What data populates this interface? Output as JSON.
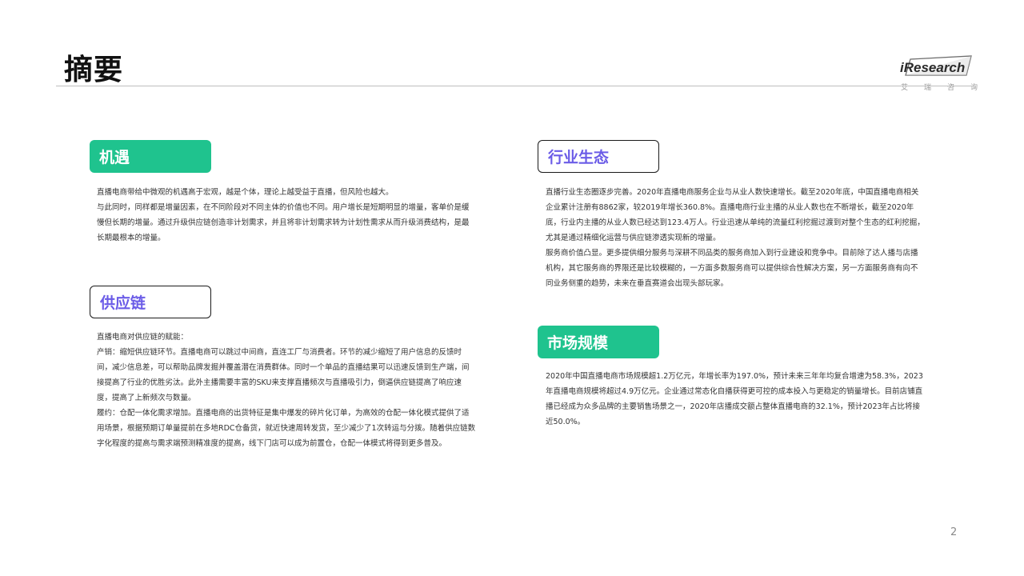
{
  "header": {
    "title": "摘要",
    "logo_text": "iResearch",
    "logo_subtitle": [
      "艾",
      "瑞",
      "咨",
      "询"
    ]
  },
  "sections": {
    "opportunity": {
      "title": "机遇",
      "paragraphs": [
        "直播电商带给中微观的机遇高于宏观，越是个体，理论上越受益于直播，但风险也越大。",
        "与此同时，同样都是增量因素，在不同阶段对不同主体的价值也不同。用户增长是短期明显的增量，客单价是缓慢但长期的增量。通过升级供应链创造非计划需求，并且将非计划需求转为计划性需求从而升级消费结构，是最长期最根本的增量。"
      ]
    },
    "supply_chain": {
      "title": "供应链",
      "paragraphs": [
        "直播电商对供应链的赋能：",
        "产销：缩短供应链环节。直播电商可以跳过中间商，直连工厂与消费者。环节的减少缩短了用户信息的反馈时间，减少信息差，可以帮助品牌发掘并覆盖潜在消费群体。同时一个单品的直播结果可以迅速反馈到生产端，间接提高了行业的优胜劣汰。此外主播需要丰富的SKU来支撑直播频次与直播吸引力，倒逼供应链提高了响应速度，提高了上新频次与数量。",
        "履约：仓配一体化需求增加。直播电商的出货特征是集中爆发的碎片化订单，为高效的仓配一体化模式提供了适用场景，根据预期订单量提前在多地RDC仓备货，就近快速周转发货，至少减少了1次转运与分拨。随着供应链数字化程度的提高与需求端预测精准度的提高，线下门店可以成为前置仓，仓配一体模式将得到更多普及。"
      ]
    },
    "ecosystem": {
      "title": "行业生态",
      "paragraphs": [
        "直播行业生态圈逐步完善。2020年直播电商服务企业与从业人数快速增长。截至2020年底，中国直播电商相关企业累计注册有8862家，较2019年增长360.8%。直播电商行业主播的从业人数也在不断增长，截至2020年底，行业内主播的从业人数已经达到123.4万人。行业迅速从单纯的流量红利挖掘过渡到对整个生态的红利挖掘，尤其是通过精细化运营与供应链渗透实现新的增量。",
        "服务商价值凸显。更多提供细分服务与深耕不同品类的服务商加入到行业建设和竞争中。目前除了达人播与店播机构，其它服务商的界限还是比较模糊的，一方面多数服务商可以提供综合性解决方案，另一方面服务商有向不同业务侧重的趋势，未来在垂直赛道会出现头部玩家。"
      ]
    },
    "market_size": {
      "title": "市场规模",
      "paragraphs": [
        "2020年中国直播电商市场规模超1.2万亿元，年增长率为197.0%，预计未来三年年均复合增速为58.3%，2023年直播电商规模将超过4.9万亿元。企业通过常态化自播获得更可控的成本投入与更稳定的销量增长。目前店铺直播已经成为众多品牌的主要销售场景之一，2020年店播成交额占整体直播电商的32.1%，预计2023年占比将接近50.0%。"
      ]
    }
  },
  "footer": {
    "page_number": "2"
  },
  "colors": {
    "accent_green": "#1fc38e",
    "accent_purple": "#6b5ce7",
    "rule_gray": "#bdbdbd"
  }
}
